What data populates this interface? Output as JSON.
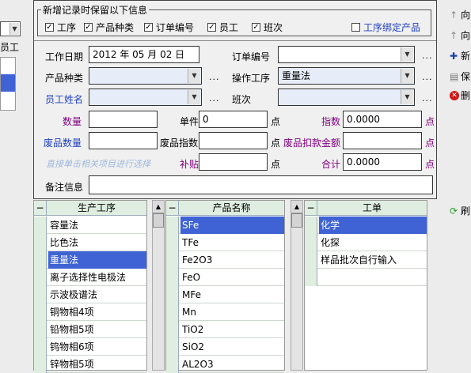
{
  "left_panel": {
    "combo_value": "",
    "label": "员工"
  },
  "group": {
    "title": "新增记录时保留以下信息",
    "checks": [
      {
        "label": "工序",
        "checked": true
      },
      {
        "label": "产品种类",
        "checked": true
      },
      {
        "label": "订单编号",
        "checked": true
      },
      {
        "label": "员工",
        "checked": true
      },
      {
        "label": "班次",
        "checked": true
      }
    ],
    "bind_check": {
      "label": "工序绑定产品",
      "checked": false
    }
  },
  "form": {
    "work_date_label": "工作日期",
    "work_date_value": "2012 年 05 月 02 日",
    "order_label": "订单编号",
    "order_value": "",
    "product_type_label": "产品种类",
    "product_type_value": "",
    "process_label": "操作工序",
    "process_value": "重量法",
    "employee_label": "员工姓名",
    "employee_value": "",
    "shift_label": "班次",
    "shift_value": "",
    "qty_label": "数量",
    "qty_value": "",
    "unit_price_label": "单件",
    "unit_price_value": "0",
    "point": "点",
    "index_label": "指数",
    "index_value": "0.0000",
    "waste_qty_label": "废品数量",
    "waste_qty_value": "",
    "waste_index_label": "废品指数",
    "waste_index_value": "",
    "waste_deduct_label": "废品扣款金额",
    "waste_deduct_value": "",
    "hint": "直接单击相关项目进行选择",
    "subsidy_label": "补贴",
    "subsidy_value": "",
    "total_label": "合计",
    "total_value": "0.0000",
    "note_label": "备注信息",
    "note_value": "",
    "dots": "..."
  },
  "lists": {
    "process": {
      "header": "生产工序",
      "items": [
        "容量法",
        "比色法",
        "重量法",
        "离子选择性电极法",
        "示波极谱法",
        "铜物相4项",
        "铅物相5项",
        "钨物相6项",
        "锌物相5项"
      ],
      "selected": 2
    },
    "product": {
      "header": "产品名称",
      "items": [
        "SFe",
        "TFe",
        "Fe2O3",
        "FeO",
        "MFe",
        "Mn",
        "TiO2",
        "SiO2",
        "AL2O3"
      ],
      "selected": 0
    },
    "order": {
      "header": "工单",
      "items": [
        "化学",
        "化探",
        "样品批次自行输入",
        ""
      ],
      "selected": 0
    }
  },
  "toolbar": {
    "items": [
      "向",
      "向",
      "新",
      "保",
      "删",
      "刷"
    ]
  },
  "colors": {
    "selection": "#3f63d4",
    "list_header": "#dfeee0",
    "label_blue": "#2040c0",
    "label_purple": "#800080"
  }
}
